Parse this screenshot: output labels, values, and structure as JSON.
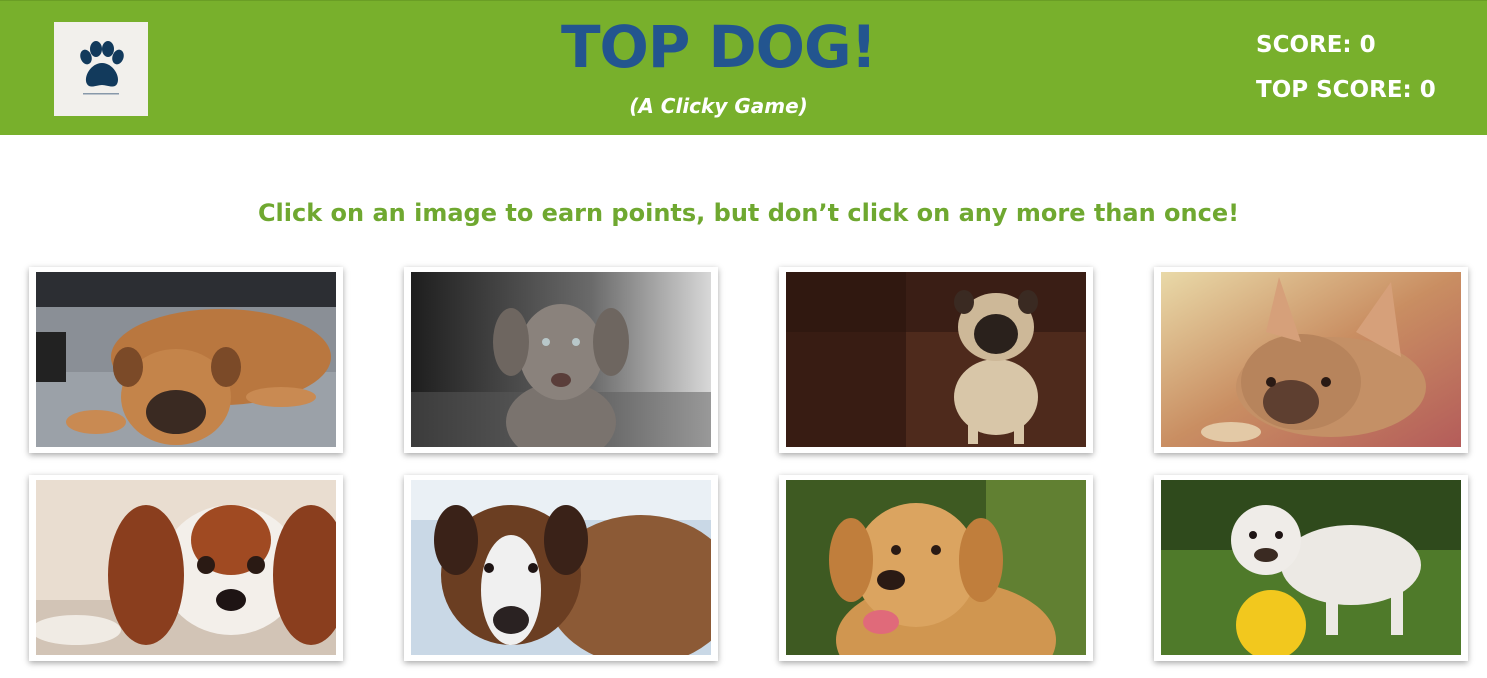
{
  "header": {
    "logo_icon": "paw-icon",
    "title": "TOP DOG!",
    "subtitle": "(A Clicky Game)",
    "score_label": "SCORE: 0",
    "top_score_label": "TOP SCORE: 0"
  },
  "instructions": "Click on an image to earn points, but don’t click on any more than once!",
  "colors": {
    "header_bg": "#78b02c",
    "title": "#23558f",
    "instructions": "#6fa830"
  },
  "cards": [
    {
      "name": "boxer-dog-card"
    },
    {
      "name": "weimaraner-puppy-card"
    },
    {
      "name": "pug-card"
    },
    {
      "name": "french-bulldog-card"
    },
    {
      "name": "cavalier-spaniel-card"
    },
    {
      "name": "saint-bernard-card"
    },
    {
      "name": "golden-retriever-card"
    },
    {
      "name": "english-bulldog-card"
    }
  ]
}
